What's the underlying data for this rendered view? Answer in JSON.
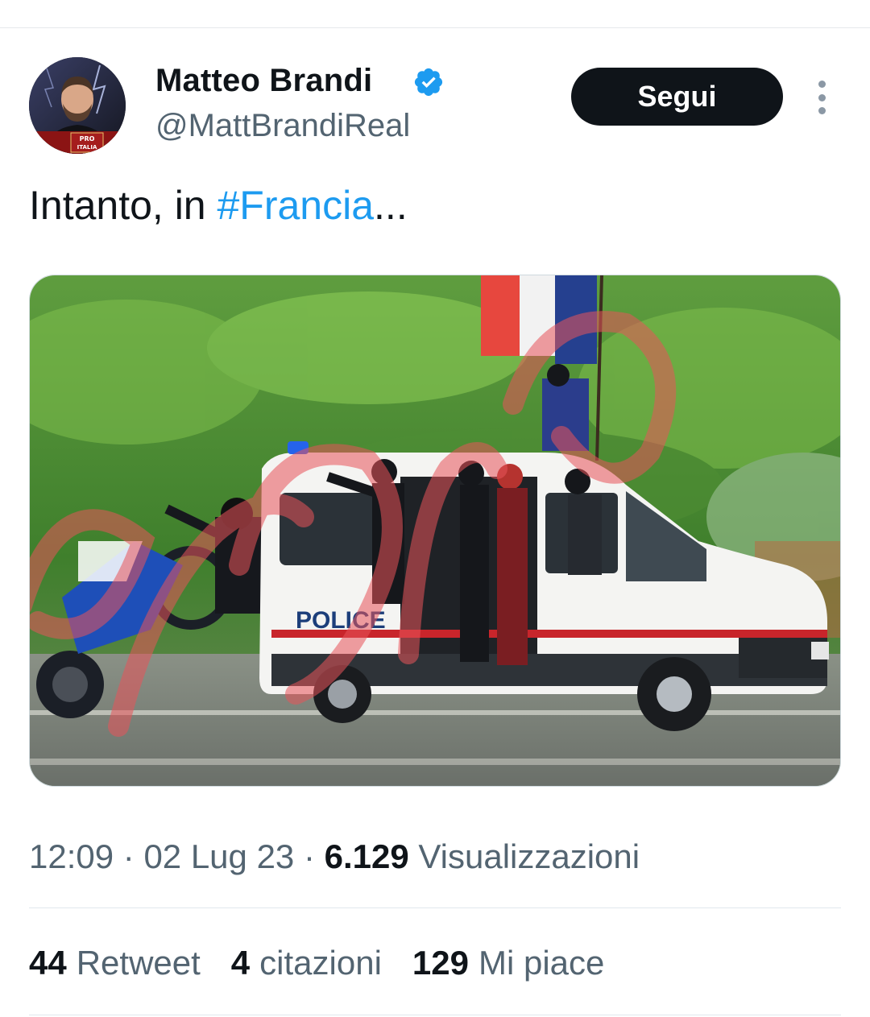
{
  "author": {
    "name": "Matteo Brandi",
    "handle": "@MattBrandiReal",
    "verified_icon": "verified-badge-icon",
    "verified_color": "#1d9bf0",
    "avatar_badge_lines": [
      "PRO",
      "ITALIA"
    ]
  },
  "follow_button": {
    "label": "Segui"
  },
  "tweet": {
    "text_prefix": "Intanto, in ",
    "hashtag": "#Francia",
    "text_suffix": "...",
    "hashtag_color": "#1d9bf0",
    "image_van_label": "POLICE"
  },
  "meta": {
    "time": "12:09",
    "separator": " · ",
    "date": "02 Lug 23",
    "views_count": "6.129",
    "views_label": "Visualizzazioni"
  },
  "stats": {
    "retweets_count": "44",
    "retweets_label": "Retweet",
    "quotes_count": "4",
    "quotes_label": "citazioni",
    "likes_count": "129",
    "likes_label": "Mi piace"
  },
  "colors": {
    "text_primary": "#0f1419",
    "text_secondary": "#536471",
    "button_bg": "#0f1419"
  }
}
